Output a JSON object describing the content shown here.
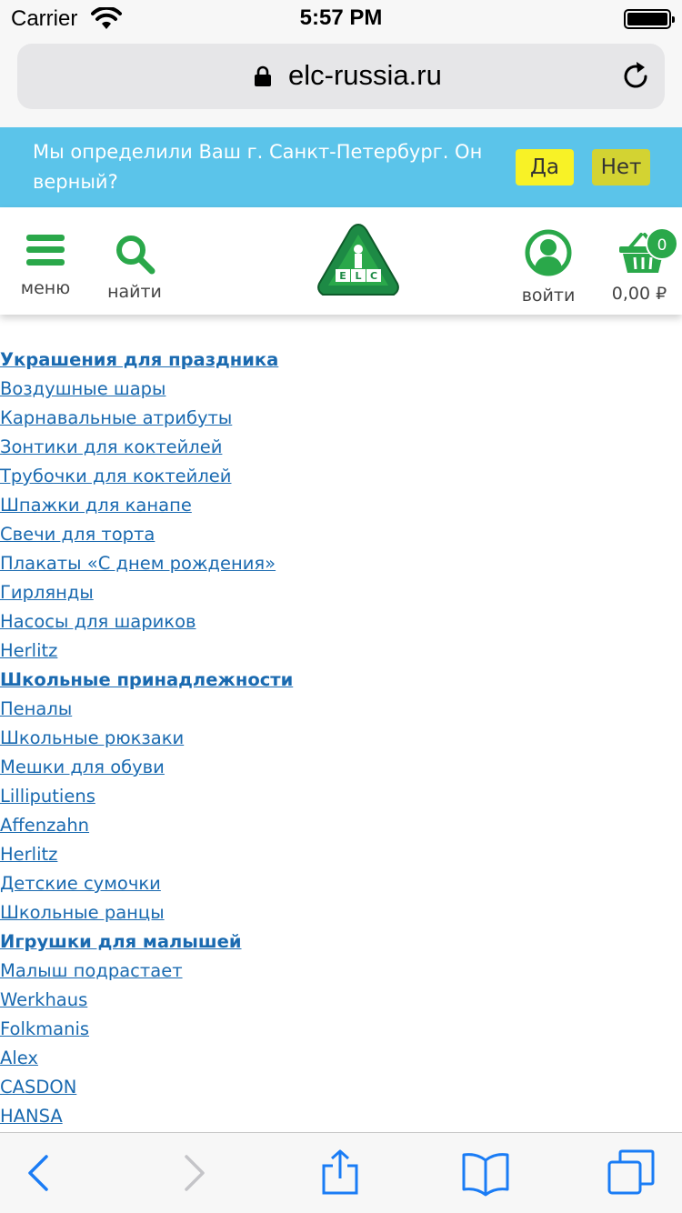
{
  "status_bar": {
    "carrier": "Carrier",
    "time": "5:57 PM"
  },
  "browser": {
    "url": "elc-russia.ru"
  },
  "geo_banner": {
    "message": "Мы определили Ваш г. Санкт-Петербург. Он верный?",
    "yes_label": "Да",
    "no_label": "Нет",
    "background": "#5bc4ea",
    "yes_color": "#f8f226",
    "no_color": "#d3d332"
  },
  "header": {
    "menu_label": "меню",
    "search_label": "найти",
    "login_label": "войти",
    "cart_count": "0",
    "cart_total": "0,00 ₽",
    "logo_letters": [
      "E",
      "L",
      "C"
    ],
    "accent_color": "#2aa84a"
  },
  "links": [
    {
      "label": "Украшения для праздника",
      "heading": true
    },
    {
      "label": "Воздушные шары",
      "heading": false
    },
    {
      "label": "Карнавальные атрибуты",
      "heading": false
    },
    {
      "label": "Зонтики для коктейлей",
      "heading": false
    },
    {
      "label": "Трубочки для коктейлей",
      "heading": false
    },
    {
      "label": "Шпажки для канапе",
      "heading": false
    },
    {
      "label": "Свечи для торта",
      "heading": false
    },
    {
      "label": "Плакаты «С днем рождения»",
      "heading": false
    },
    {
      "label": "Гирлянды",
      "heading": false
    },
    {
      "label": "Насосы для шариков",
      "heading": false
    },
    {
      "label": "Herlitz",
      "heading": false
    },
    {
      "label": "Школьные принадлежности",
      "heading": true
    },
    {
      "label": "Пеналы",
      "heading": false
    },
    {
      "label": "Школьные рюкзаки",
      "heading": false
    },
    {
      "label": "Мешки для обуви",
      "heading": false
    },
    {
      "label": "Lilliputiens",
      "heading": false
    },
    {
      "label": "Affenzahn",
      "heading": false
    },
    {
      "label": "Herlitz",
      "heading": false
    },
    {
      "label": "Детские сумочки",
      "heading": false
    },
    {
      "label": "Школьные ранцы",
      "heading": false
    },
    {
      "label": "Игрушки для малышей",
      "heading": true
    },
    {
      "label": "Малыш подрастает",
      "heading": false
    },
    {
      "label": "Werkhaus",
      "heading": false
    },
    {
      "label": "Folkmanis",
      "heading": false
    },
    {
      "label": "Alex",
      "heading": false
    },
    {
      "label": "CASDON",
      "heading": false
    },
    {
      "label": "HANSA",
      "heading": false
    }
  ],
  "toolbar": {
    "icons": [
      "back-icon",
      "forward-icon",
      "share-icon",
      "bookmarks-icon",
      "tabs-icon"
    ],
    "tint": "#1a7cf5"
  }
}
